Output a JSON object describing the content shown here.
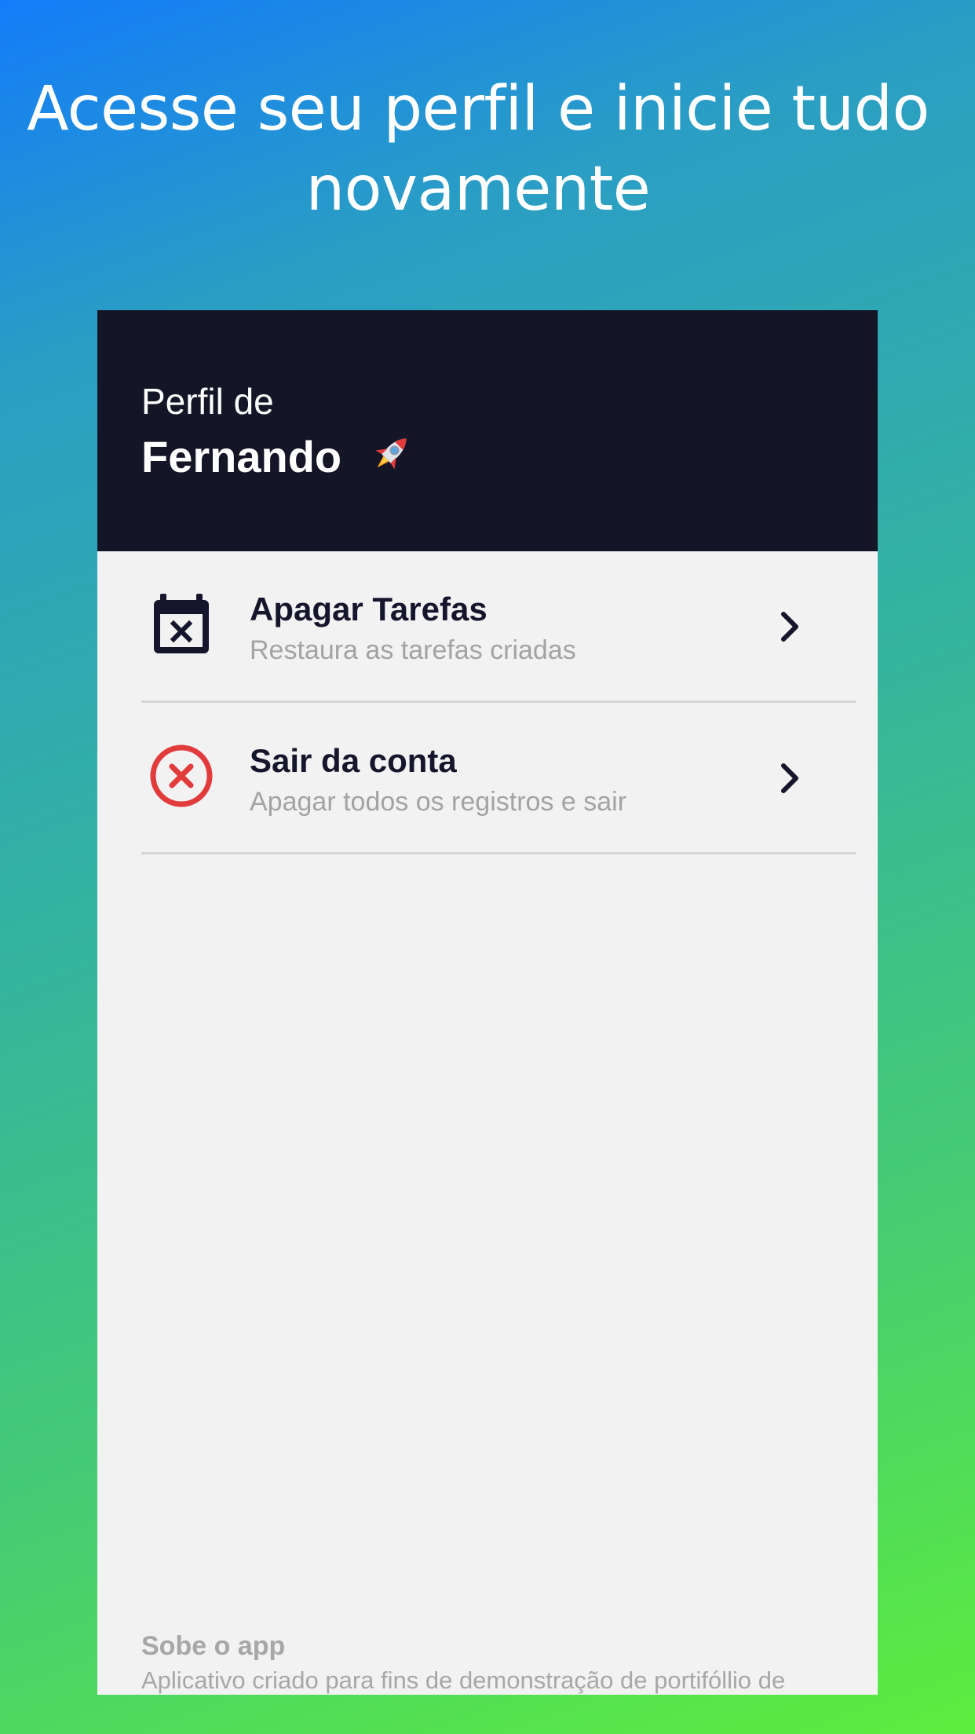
{
  "headline": {
    "line1": "Acesse seu perfil e inicie tudo",
    "line2": "novamente"
  },
  "profile": {
    "label": "Perfil de",
    "name": "Fernando",
    "emoji_icon": "rocket-icon"
  },
  "menu": {
    "items": [
      {
        "title": "Apagar Tarefas",
        "subtitle": "Restaura as tarefas criadas",
        "icon": "calendar-remove-icon"
      },
      {
        "title": "Sair da conta",
        "subtitle": "Apagar todos os registros e sair",
        "icon": "close-circle-icon"
      }
    ]
  },
  "about": {
    "title": "Sobe o app",
    "text": "Aplicativo criado para fins de demonstração de portifóllio de"
  },
  "colors": {
    "gradient_start": "#137cf9",
    "gradient_end": "#5ded3d",
    "header_bg": "#141526",
    "screen_bg": "#f2f2f3",
    "danger": "#e23b3b",
    "text_dark": "#15162b",
    "text_muted": "#a3a3a6"
  }
}
